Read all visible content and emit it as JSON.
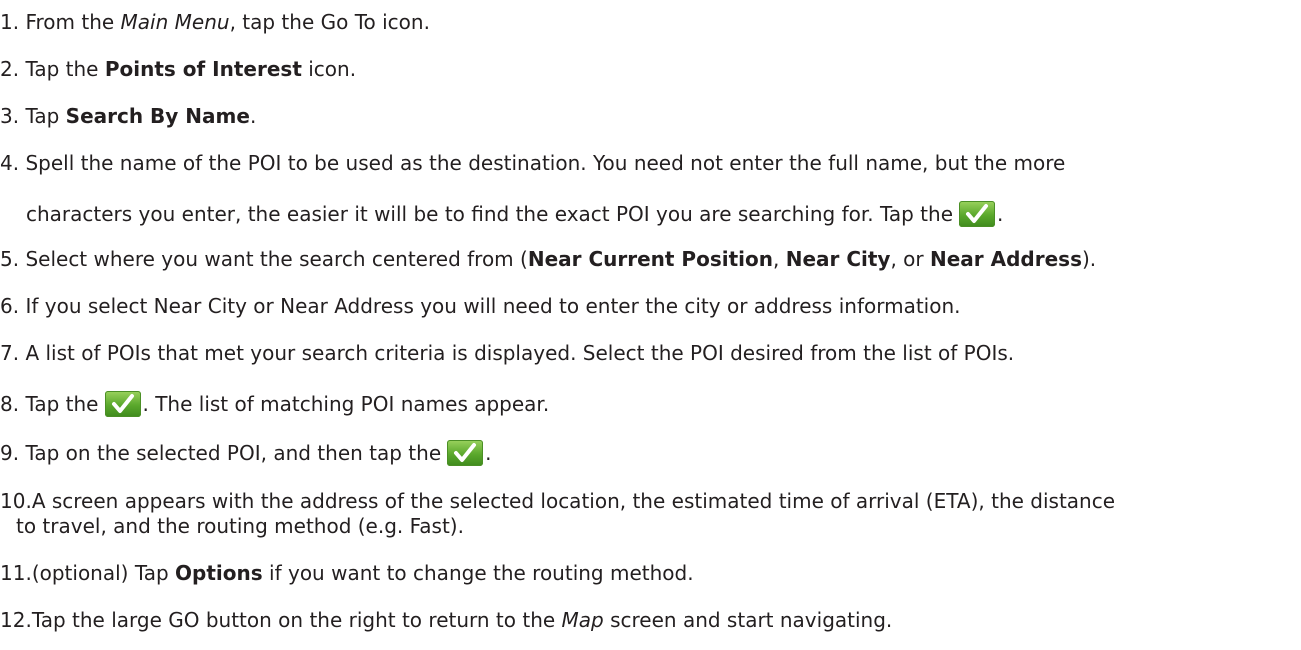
{
  "steps": [
    {
      "num": "1.",
      "a": "From the ",
      "i": "Main Menu",
      "b": ", tap the Go To icon."
    },
    {
      "num": "2.",
      "a": "Tap the ",
      "bold": "Points of Interest",
      "b": " icon."
    },
    {
      "num": "3.",
      "a": "Tap ",
      "bold": "Search By Name",
      "b": "."
    },
    {
      "num": "4.",
      "a": "Spell the name of the POI to be used as the destination. You need not enter the full name, but the more",
      "cont": "characters you enter, the easier it will be to find the exact POI you are searching for.  Tap the",
      "end": "."
    },
    {
      "num": "5.",
      "a": "Select where you want the search centered from (",
      "b1": "Near Current Position",
      "s1": ", ",
      "b2": "Near City",
      "s2": ", or ",
      "b3": "Near Address",
      "s3": ")."
    },
    {
      "num": "6.",
      "a": "If you select Near City or Near Address you will need to enter the city or address information."
    },
    {
      "num": "7.",
      "a": "A list of POIs that met your search criteria is displayed.  Select the POI desired from the list of POIs."
    },
    {
      "num": "8.",
      "a": "Tap the",
      "b": ". The list of matching POI names appear."
    },
    {
      "num": "9.",
      "a": "Tap on the selected POI, and then tap the",
      "b": "."
    },
    {
      "num": "10.",
      "a": "A screen appears with the address of the selected location, the estimated time of arrival (ETA), the distance",
      "cont": "to travel, and the routing method (e.g. Fast)."
    },
    {
      "num": "11.",
      "a": "(optional) Tap ",
      "bold": "Options",
      "b": " if you want to change the routing method."
    },
    {
      "num": "12.",
      "a": "Tap the large GO  button on the right to return to the ",
      "i": "Map",
      "b": " screen and start navigating."
    }
  ],
  "icon": {
    "name": "checkmark-icon",
    "color": "#5aa82c"
  }
}
